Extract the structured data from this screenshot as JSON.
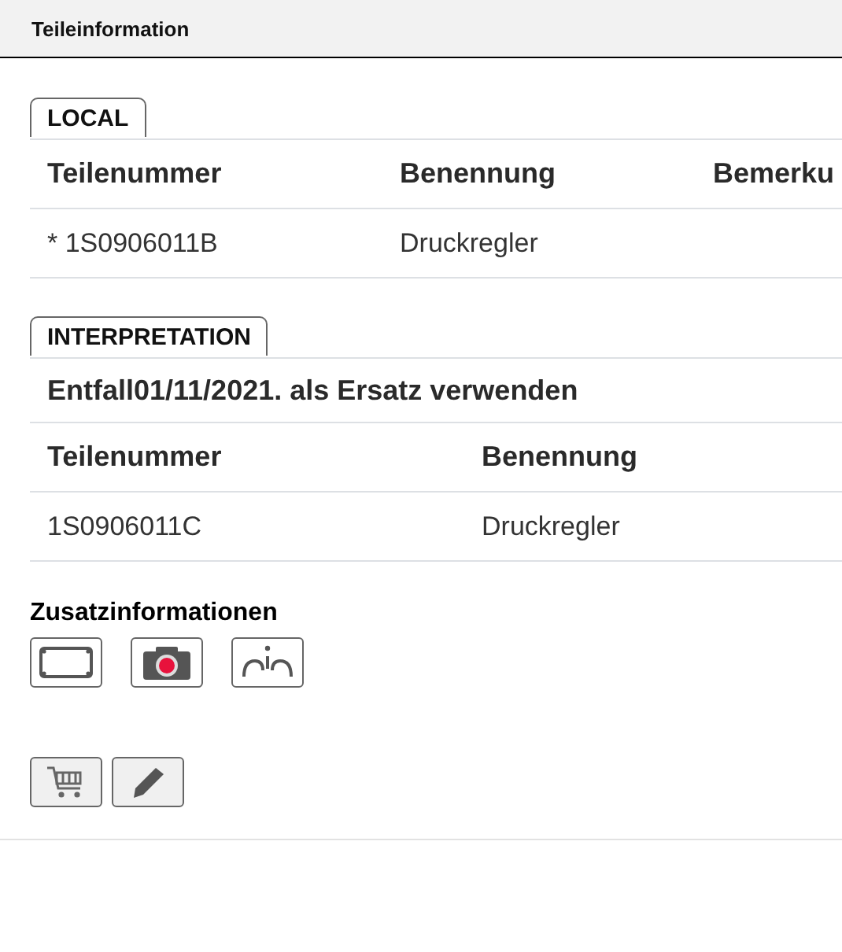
{
  "window": {
    "title": "Teileinformation"
  },
  "local": {
    "tab": "LOCAL",
    "columns": [
      "Teilenummer",
      "Benennung",
      "Bemerku"
    ],
    "rows": [
      [
        "* 1S0906011B",
        "Druckregler",
        ""
      ]
    ]
  },
  "interpretation": {
    "tab": "INTERPRETATION",
    "note": "Entfall01/11/2021. als Ersatz verwenden",
    "columns": [
      "Teilenummer",
      "Benennung"
    ],
    "rows": [
      [
        "1S0906011C",
        "Druckregler"
      ]
    ]
  },
  "extra": {
    "title": "Zusatzinformationen"
  }
}
